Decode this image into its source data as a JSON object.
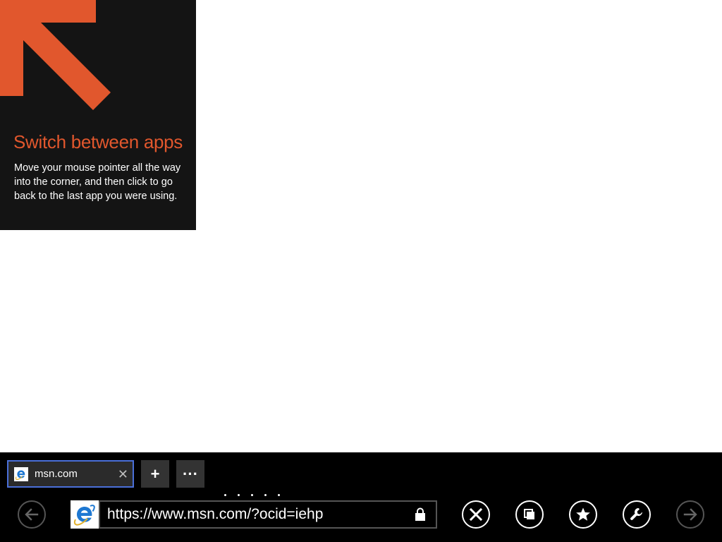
{
  "tip": {
    "title": "Switch between apps",
    "body": "Move your mouse pointer all the way into the corner, and then click to go back to the last app you were using.",
    "arrow_icon": "arrow-up-left-icon",
    "accent": "#e1572d",
    "background": "#141414"
  },
  "appbar": {
    "tab": {
      "label": "msn.com",
      "close": "✕",
      "icon": "ie-favicon-icon"
    },
    "new_tab": "+",
    "more": "···",
    "address": {
      "url": "https://www.msn.com/?ocid=iehp",
      "icon": "ie-logo-icon",
      "lock_icon": "lock-icon"
    },
    "buttons": {
      "back": "back-arrow-icon",
      "stop": "stop-icon",
      "tabs": "tabs-icon",
      "pin": "favorites-star-icon",
      "tools": "wrench-icon",
      "forward": "forward-arrow-icon"
    },
    "accent": "#4a6fd8"
  }
}
